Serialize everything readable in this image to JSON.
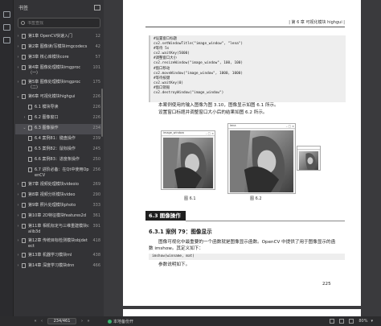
{
  "sidebar": {
    "title": "书签",
    "search_placeholder": "书签查找",
    "items": [
      {
        "label": "第1章  OpenCV快速入门",
        "page": "12",
        "chev": "›",
        "indent": 0
      },
      {
        "label": "第2章  图像读/写模块imgcodecs",
        "page": "42",
        "chev": "›",
        "indent": 0
      },
      {
        "label": "第3章  核心库模块core",
        "page": "57",
        "chev": "›",
        "indent": 0
      },
      {
        "label": "第4章  图像处理模块imgproc（一）",
        "page": "101",
        "chev": "›",
        "indent": 0
      },
      {
        "label": "第5章  图像处理模块imgproc（二）",
        "page": "175",
        "chev": "›",
        "indent": 0
      },
      {
        "label": "第6章  可视化模块highgui",
        "page": "226",
        "chev": "⌄",
        "indent": 0
      },
      {
        "label": "6.1  模块导读",
        "page": "226",
        "chev": "",
        "indent": 1
      },
      {
        "label": "6.2  图像窗口",
        "page": "226",
        "chev": "›",
        "indent": 1
      },
      {
        "label": "6.3  图像操作",
        "page": "234",
        "chev": "⌄",
        "indent": 1
      },
      {
        "label": "6.4  案例81：键盘操作",
        "page": "239",
        "chev": "",
        "indent": 1
      },
      {
        "label": "6.5  案例82：鼠标操作",
        "page": "245",
        "chev": "",
        "indent": 1
      },
      {
        "label": "6.6  案例83：进度条操作",
        "page": "250",
        "chev": "",
        "indent": 1
      },
      {
        "label": "6.7  进阶必备：在Qt中使用OpenCV",
        "page": "256",
        "chev": "",
        "indent": 1
      },
      {
        "label": "第7章  视频处理模块videoio",
        "page": "269",
        "chev": "›",
        "indent": 0
      },
      {
        "label": "第8章  视频分析模块video",
        "page": "290",
        "chev": "›",
        "indent": 0
      },
      {
        "label": "第9章  照片处理模块photo",
        "page": "333",
        "chev": "›",
        "indent": 0
      },
      {
        "label": "第10章  2D特征模块features2d",
        "page": "361",
        "chev": "›",
        "indent": 0
      },
      {
        "label": "第11章  相机标定与三维重建模块calib3d",
        "page": "391",
        "chev": "›",
        "indent": 0
      },
      {
        "label": "第12章  传统目标检测模块objdetect",
        "page": "418",
        "chev": "›",
        "indent": 0
      },
      {
        "label": "第13章  机器学习模块ml",
        "page": "438",
        "chev": "›",
        "indent": 0
      },
      {
        "label": "第14章  深度学习模块dnn",
        "page": "466",
        "chev": "›",
        "indent": 0
      }
    ]
  },
  "toolbar": {
    "page_indicator": "234/461",
    "status": "本地备份开",
    "zoom": "80%"
  },
  "page": {
    "header": "| 第 6 章  可视化模块 highgui |",
    "code_lines": [
      "#设置窗口标题",
      "cv2.setWindowTitle(\"image_window\", \"lena\")",
      "#等待 5s",
      "cv2.waitKey(5000)",
      "#调整窗口大小",
      "cv2.resizeWindow(\"image_window\", 100, 100)",
      "#窗口移动",
      "cv2.moveWindow(\"image_window\", 1000, 1000)",
      "#等待按键",
      "cv2.waitKey(0)",
      "#窗口销毁",
      "cv2.destroyWindow(\"image_window\")"
    ],
    "para1": "本案例使用的输入图像为图 3.10，图像显示如图 6.1 所示。",
    "para2": "设置窗口标题并调整窗口大小后的结果如图 6.2 所示。",
    "fig1_title": "image_window",
    "fig2_title": "lena",
    "fig1_caption": "图 6.1",
    "fig2_caption": "图 6.2",
    "section_heading": "6.3  图像操作",
    "subsection_heading": "6.3.1    案例 79：图像显示",
    "para3_line1": "图像可视化中最重要的一个函数就是图像显示函数。OpenCV 中提供了用于图像显示的函",
    "para3_line2": "数 imshow。其定义如下：",
    "inline_code": "imshow(winname, mat)",
    "para4": "参数说明如下。",
    "page_number": "225"
  }
}
